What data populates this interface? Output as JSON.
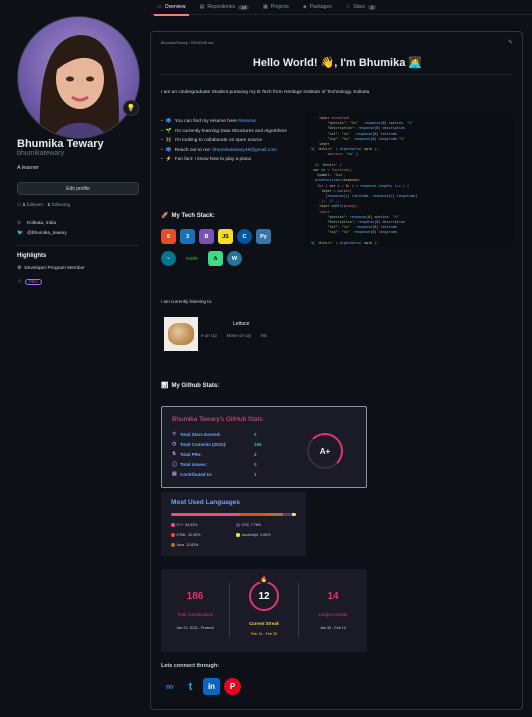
{
  "tabs": [
    {
      "label": "Overview",
      "icon": "book-icon",
      "count": ""
    },
    {
      "label": "Repositories",
      "icon": "repo-icon",
      "count": "19"
    },
    {
      "label": "Projects",
      "icon": "project-icon",
      "count": ""
    },
    {
      "label": "Packages",
      "icon": "package-icon",
      "count": ""
    },
    {
      "label": "Stars",
      "icon": "star-icon",
      "count": "2"
    }
  ],
  "profile": {
    "avatar_emoji": "💡",
    "name": "Bhumika Tewary",
    "username": "bhumikatewary",
    "bio": "A learner",
    "edit_label": "Edit profile",
    "followers_count": "1",
    "followers_label": "follower",
    "following_count": "1",
    "following_label": "following",
    "location": "Kolkata, India",
    "twitter": "@bhumika_tewary"
  },
  "highlights": {
    "title": "Highlights",
    "item": "Developer Program Member",
    "badge": "PRO"
  },
  "readme": {
    "path": "BhumikaTewary / README.md",
    "heading": "Hello World! 👋, I'm Bhumika 👩‍💻",
    "intro": "I am an Undergraduate Student pursuing my B.Tech from Heritage Institute of Technology, Kolkata",
    "bullets": [
      {
        "emoji": "📫",
        "text": "You can find my resume here ",
        "link": "Resume"
      },
      {
        "emoji": "🌱",
        "text": "I'm currently learning Data Structures and Algorithms",
        "link": ""
      },
      {
        "emoji": "👯",
        "text": "I'm looking to collaborate on open source",
        "link": ""
      },
      {
        "emoji": "📫",
        "text": "Reach out to me: ",
        "link": "bhumikatewary49@gmail.com"
      },
      {
        "emoji": "⚡",
        "text": "Fun fact: I know how to play a piano",
        "link": ""
      }
    ],
    "tech_title": "My Tech Stack:",
    "listening_label": "I am currently listening to:",
    "song_title": "Lettuce",
    "song_sub": [
      "e on Up",
      "Move on Up",
      "Mc"
    ],
    "stats_title": "My Github Stats:",
    "connect_label": "Lets connect through:"
  },
  "tech_icons": [
    {
      "name": "html5-icon",
      "text": "5",
      "color": "#e44d26"
    },
    {
      "name": "css3-icon",
      "text": "3",
      "color": "#1572b6"
    },
    {
      "name": "bootstrap-icon",
      "text": "B",
      "color": "#7952b3"
    },
    {
      "name": "javascript-icon",
      "text": "JS",
      "color": "#f7df1e"
    },
    {
      "name": "cplusplus-icon",
      "text": "C",
      "color": "#00599c"
    },
    {
      "name": "python-icon",
      "text": "Py",
      "color": "#3776ab"
    },
    {
      "name": "mysql-icon",
      "text": "~",
      "color": "#00758f"
    },
    {
      "name": "nodejs-icon",
      "text": "node",
      "color": "#3c873a"
    },
    {
      "name": "android-icon",
      "text": "A",
      "color": "#3ddc84"
    },
    {
      "name": "wordpress-icon",
      "text": "W",
      "color": "#21759b"
    }
  ],
  "github_stats": {
    "title": "Bhumika Tewary's GitHub Stats",
    "rows": [
      {
        "icon": "☆",
        "label": "Total Stars Earned:",
        "value": "0"
      },
      {
        "icon": "◷",
        "label": "Total Commits (2022):",
        "value": "165"
      },
      {
        "icon": "⇅",
        "label": "Total PRs:",
        "value": "4"
      },
      {
        "icon": "ⓘ",
        "label": "Total Issues:",
        "value": "0"
      },
      {
        "icon": "▤",
        "label": "Contributed to:",
        "value": "1"
      }
    ],
    "grade": "A+"
  },
  "languages": {
    "title": "Most Used Languages",
    "items": [
      {
        "name": "C++",
        "percent": "54.53%",
        "fraction": 0.5453,
        "color": "#f34b7d"
      },
      {
        "name": "CSS",
        "percent": "7.78%",
        "fraction": 0.0778,
        "color": "#563d7c"
      },
      {
        "name": "HTML",
        "percent": "22.59%",
        "fraction": 0.2259,
        "color": "#e34c26"
      },
      {
        "name": "JavaScript",
        "percent": "3.06%",
        "fraction": 0.0306,
        "color": "#f1e05a"
      },
      {
        "name": "Java",
        "percent": "12.63%",
        "fraction": 0.1263,
        "color": "#b07219"
      }
    ]
  },
  "streak": {
    "total": "186",
    "total_label": "Total Contributions",
    "total_range": "Jan 21, 2021 - Present",
    "current": "12",
    "current_label": "Current Streak",
    "current_range": "Feb 14 - Feb 25",
    "longest": "14",
    "longest_label": "Longest Streak",
    "longest_range": "Jan 30 - Feb 12"
  },
  "social": [
    {
      "name": "meta-icon",
      "text": "∞",
      "color": "#1877f2"
    },
    {
      "name": "twitter-icon",
      "text": "t",
      "color": "#1da1f2"
    },
    {
      "name": "linkedin-icon",
      "text": "in",
      "color": "#0a66c2"
    },
    {
      "name": "pinterest-icon",
      "text": "P",
      "color": "#e60023"
    }
  ],
  "colors": {
    "accent": "#f78166",
    "link": "#58a6ff",
    "stats_title": "#e05a7c",
    "streak_pink": "#e0336f",
    "streak_yellow": "#fcc94a"
  }
}
